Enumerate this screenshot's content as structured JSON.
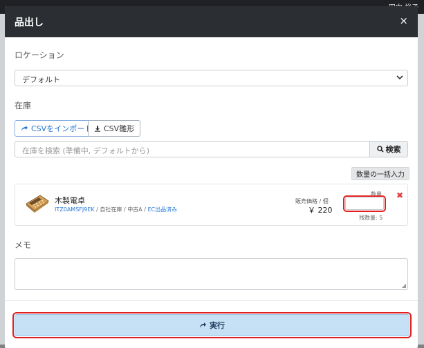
{
  "background": {
    "user_name": "田中 裕子"
  },
  "modal": {
    "title": "品出し",
    "close_glyph": "×"
  },
  "location": {
    "label": "ロケーション",
    "selected": "デフォルト"
  },
  "stock": {
    "label": "在庫",
    "import_button": "CSVをインポート",
    "template_button": "CSV雛形",
    "search_placeholder": "在庫を検索 (準備中, デフォルトから)",
    "search_button": "検索",
    "bulk_qty_button": "数量の一括入力"
  },
  "item": {
    "name": "木製電卓",
    "sku": "ITZ0AMSFJ9EK",
    "sep1": " / ",
    "location": "自社在庫",
    "sep2": " / ",
    "condition": "中古A",
    "sep3": " / ",
    "status": "EC出品済み",
    "price_label": "販売価格 / 個",
    "price": "￥ 220",
    "qty_label": "数量",
    "quantity": "",
    "remaining": "残数量: 5"
  },
  "memo": {
    "label": "メモ",
    "value": ""
  },
  "actions": {
    "execute": "実行"
  },
  "colors": {
    "header_bg": "#2b2f33",
    "accent_blue": "#1f6fd1",
    "highlight_red": "#e02020",
    "execute_bg": "#c6e0f5"
  }
}
